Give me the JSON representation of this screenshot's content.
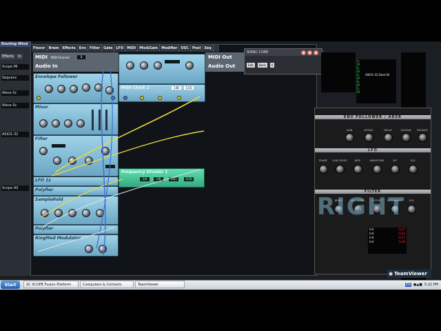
{
  "routing": {
    "title": "Routing Wind",
    "tab_effects": "Effects",
    "tab_in": "In",
    "items": [
      "Scope Mi",
      "Sequenc",
      "Wave Sc",
      "Wave Sc",
      "ASIO1-32",
      "Scope AS"
    ]
  },
  "menu": [
    "Flexor",
    "Brain",
    "Effects",
    "Env",
    "Filter",
    "Gate",
    "LFO",
    "MIDI",
    "Mix&Gain",
    "Modifier",
    "OSC",
    "Pool",
    "Seq"
  ],
  "io": {
    "midi": "MIDI",
    "midi_channel": "MIDI Channel",
    "midi_channel_value": "1",
    "audio_in": "Audio In",
    "midi_out": "MIDI Out",
    "audio_out": "Audio Out"
  },
  "modules": {
    "envelope_follower": "Envelope Follower",
    "midi_clock": "MIDI Clock 1",
    "clock_value": "148",
    "clock_value2": "1/16",
    "mixer": "Mixer",
    "filter": "Filter",
    "lfo": "LFO 1z",
    "polyfier1": "Polyfier",
    "sample_hold": "SampleHold",
    "polyfier2": "Polyfier",
    "ring_modulator": "RingMod Modulator",
    "frequency_divider": "Frequency Divider 1",
    "fd_chips": [
      "1/4",
      "1/8",
      "1/8T",
      "1/16"
    ]
  },
  "sonic_core": {
    "title": "SONIC CORE",
    "buttons": [
      "Edit",
      "Bank",
      "0"
    ]
  },
  "synth": {
    "env_header": "ENV FOLLOWER / ADSR",
    "env_labels": [
      "GAIN",
      "ATTACK",
      "DECAY",
      "SUSTAIN",
      "RELEASE"
    ],
    "lfo_header": "LFO",
    "lfo_labels": [
      "PHASE",
      "LOW CROSS",
      "RATE",
      "WAVEFORM",
      "VCF",
      "VCA"
    ],
    "filter_header": "FILTER",
    "filter_labels": [
      "DRIVE",
      "ENV SWEEP",
      "CUTOFF",
      "RESONANCE",
      "VCA"
    ],
    "big_label": "RIGHT"
  },
  "channel_list": [
    "1L",
    "1R",
    "2L",
    "2R",
    "3L",
    "3R",
    "4L",
    "4R",
    "5L",
    "5R"
  ],
  "asio_label": "ASIO1-32 Dest 64",
  "out_list": [
    {
      "in": "In4",
      "out": "Out5"
    },
    {
      "in": "In4",
      "out": "Out6"
    },
    {
      "in": "In4",
      "out": "Out7"
    },
    {
      "in": "In4",
      "out": "Out8"
    }
  ],
  "taskbar": {
    "start": "Start",
    "tasks": [
      "SC SCOPE Fusion Platform",
      "Computers & Contacts",
      "TeamViewer"
    ],
    "lang": "EN",
    "time": "5:22 PM"
  },
  "teamviewer": "TeamViewer",
  "colors": {
    "module": "#8cc6e0",
    "freq_divider": "#4ccc9c",
    "cable_yellow": "#e8d840",
    "cable_blue": "#3a6fd0"
  }
}
